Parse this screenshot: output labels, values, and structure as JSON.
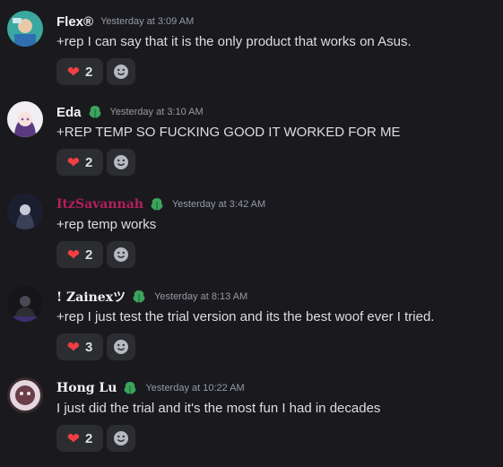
{
  "messages": [
    {
      "username": "Flex®",
      "timestamp": "Yesterday at 3:09 AM",
      "text": "+rep I can say that it is the only product that works on Asus.",
      "reaction_count": "2",
      "has_badge": false
    },
    {
      "username": "Eda",
      "timestamp": "Yesterday at 3:10 AM",
      "text": "+REP TEMP SO FUCKING GOOD IT WORKED FOR ME",
      "reaction_count": "2",
      "has_badge": true
    },
    {
      "username": "ItzSavannah",
      "timestamp": "Yesterday at 3:42 AM",
      "text": "+rep temp works",
      "reaction_count": "2",
      "has_badge": true
    },
    {
      "username": "! Zainexツ",
      "timestamp": "Yesterday at 8:13 AM",
      "text": "+rep I just test the trial version and its the best woof ever I tried.",
      "reaction_count": "3",
      "has_badge": true
    },
    {
      "username": "Hong Lu",
      "timestamp": "Yesterday at 10:22 AM",
      "text": "I just did the trial and it's the most fun I had in decades",
      "reaction_count": "2",
      "has_badge": true
    }
  ],
  "icons": {
    "reaction": "heart-icon",
    "add_reaction": "smiley-icon",
    "badge": "green-leaf-badge-icon"
  },
  "colors": {
    "background": "#1a1a1e",
    "heart": "#f23f43",
    "badge": "#3ba55d",
    "username_pink": "#b3205a"
  }
}
